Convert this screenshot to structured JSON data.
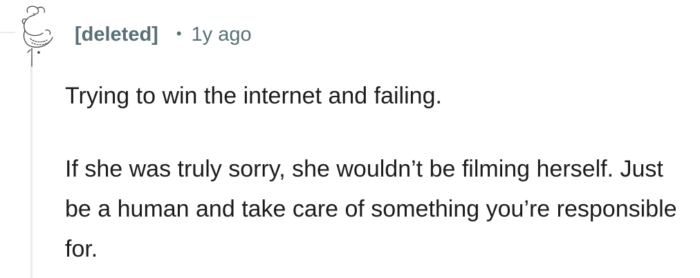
{
  "comment": {
    "author": "[deleted]",
    "separator": "•",
    "time": "1y ago",
    "paragraphs": [
      "Trying to win the internet and failing.",
      "If she was truly sorry, she wouldn’t be filming herself. Just be a human and take care of something you’re responsible for."
    ],
    "avatar_icon": "deleted-user-snoo-icon"
  },
  "colors": {
    "meta_text": "#576f76",
    "body_text": "#1c1c1c",
    "thread_line": "#e9ebed",
    "background": "#ffffff"
  }
}
